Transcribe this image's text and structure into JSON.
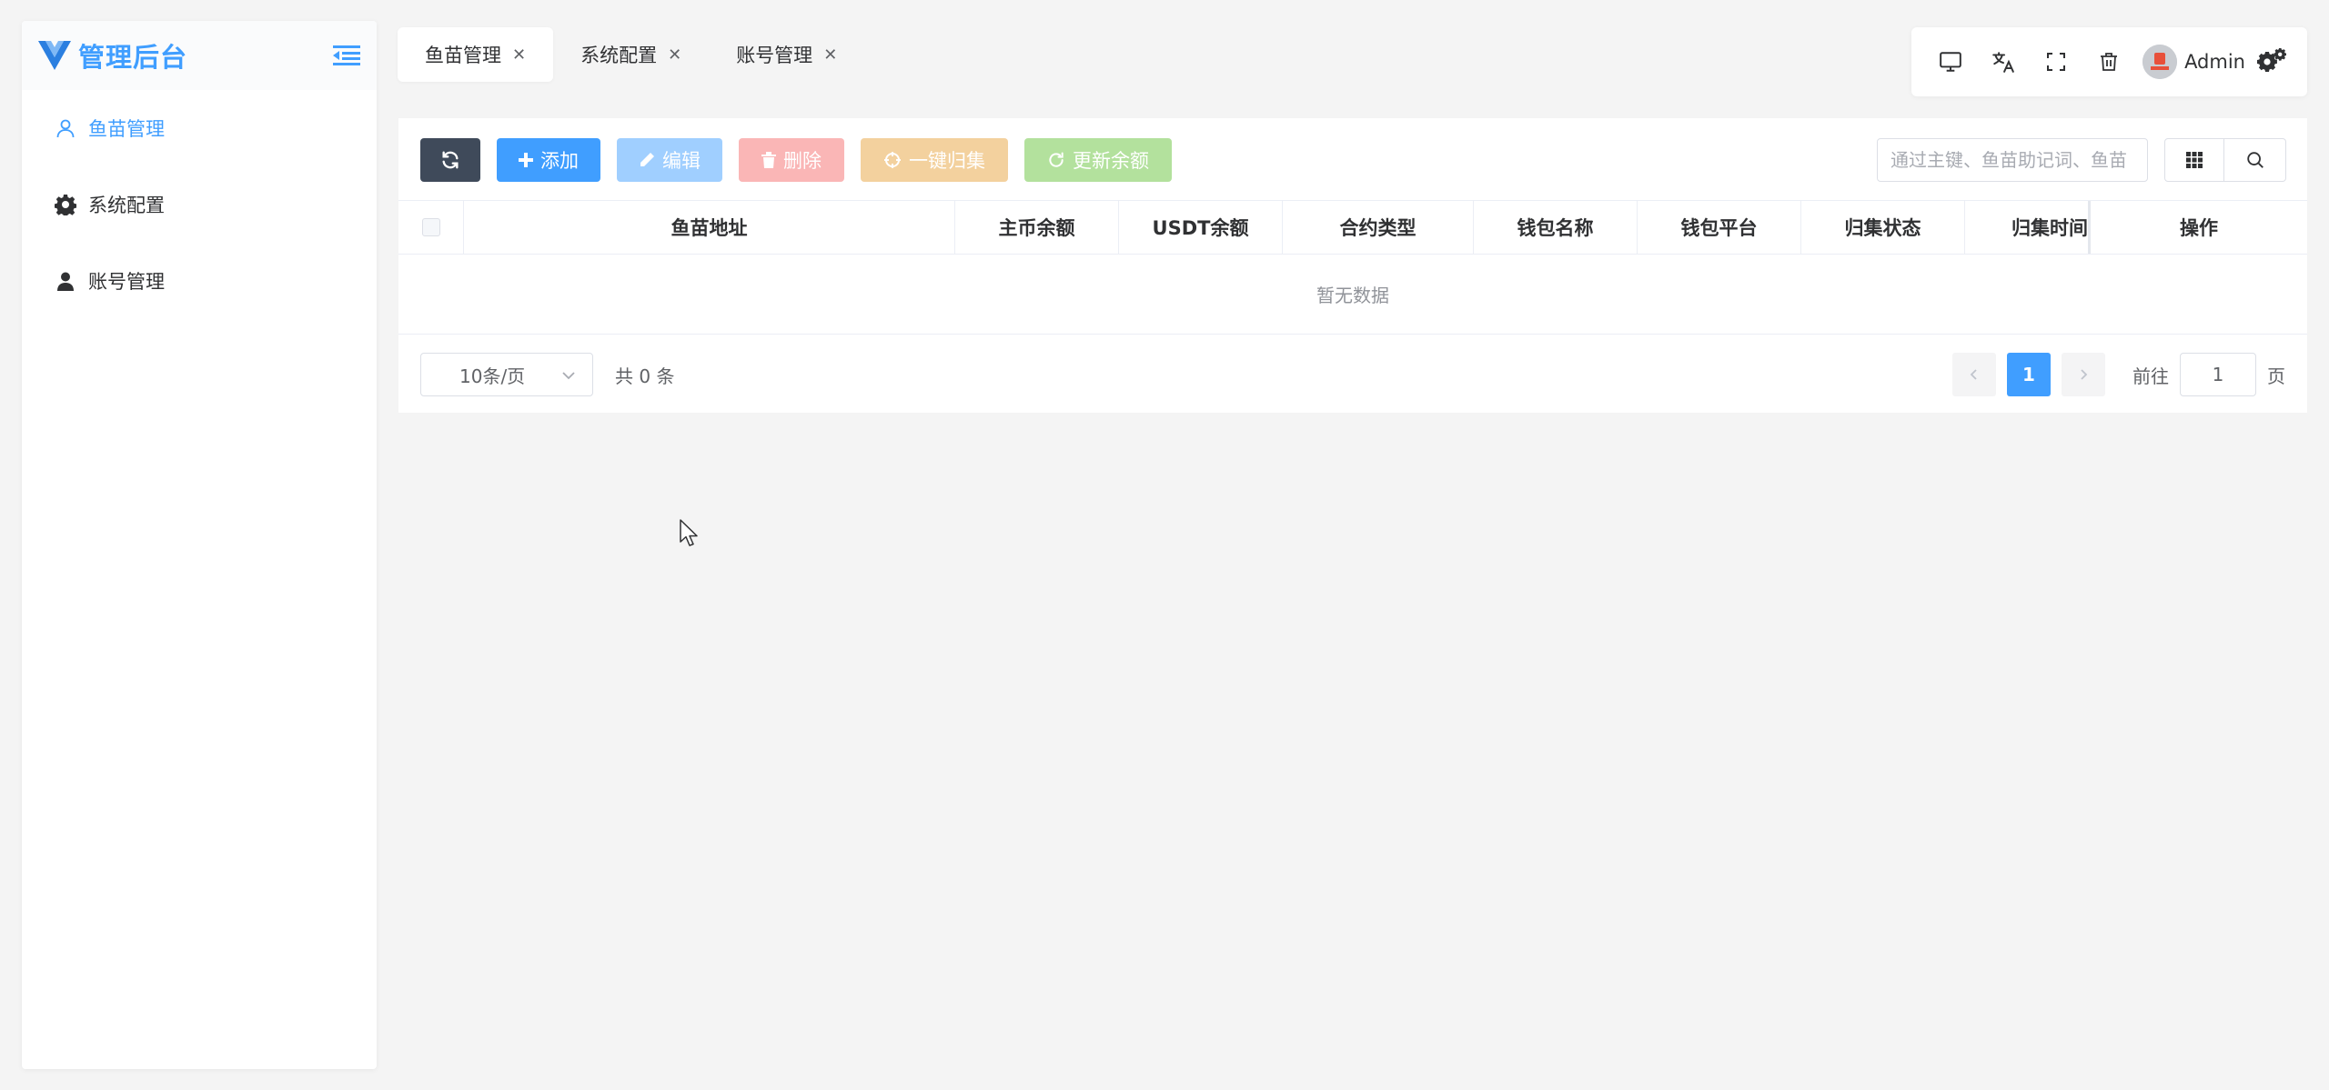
{
  "app": {
    "title": "管理后台"
  },
  "sidebar": {
    "items": [
      {
        "label": "鱼苗管理",
        "icon": "user-outline-icon",
        "active": true
      },
      {
        "label": "系统配置",
        "icon": "gear-icon",
        "active": false
      },
      {
        "label": "账号管理",
        "icon": "user-filled-icon",
        "active": false
      }
    ]
  },
  "tabs": [
    {
      "label": "鱼苗管理",
      "active": true
    },
    {
      "label": "系统配置",
      "active": false
    },
    {
      "label": "账号管理",
      "active": false
    }
  ],
  "topbar": {
    "user_name": "Admin",
    "icons": [
      "monitor-icon",
      "translate-icon",
      "fullscreen-icon",
      "trash-icon",
      "avatar",
      "settings-gears-icon"
    ]
  },
  "toolbar": {
    "add_label": "添加",
    "edit_label": "编辑",
    "delete_label": "删除",
    "collect_label": "一键归集",
    "update_label": "更新余额",
    "search_placeholder": "通过主键、鱼苗助记词、鱼苗"
  },
  "table": {
    "columns": [
      "鱼苗地址",
      "主币余额",
      "USDT余额",
      "合约类型",
      "钱包名称",
      "钱包平台",
      "归集状态",
      "归集时间",
      "操作"
    ],
    "rows": [],
    "empty_text": "暂无数据"
  },
  "pagination": {
    "page_size": "10条/页",
    "total_text": "共 0 条",
    "current_page": "1",
    "goto_prefix": "前往",
    "goto_value": "1",
    "goto_suffix": "页"
  },
  "colors": {
    "primary": "#409eff",
    "dark": "#3f4a5a",
    "edit_disabled": "#a0cfff",
    "delete_disabled": "#fab6b6",
    "collect_disabled": "#f3d19e",
    "update_disabled": "#b3e19d"
  }
}
